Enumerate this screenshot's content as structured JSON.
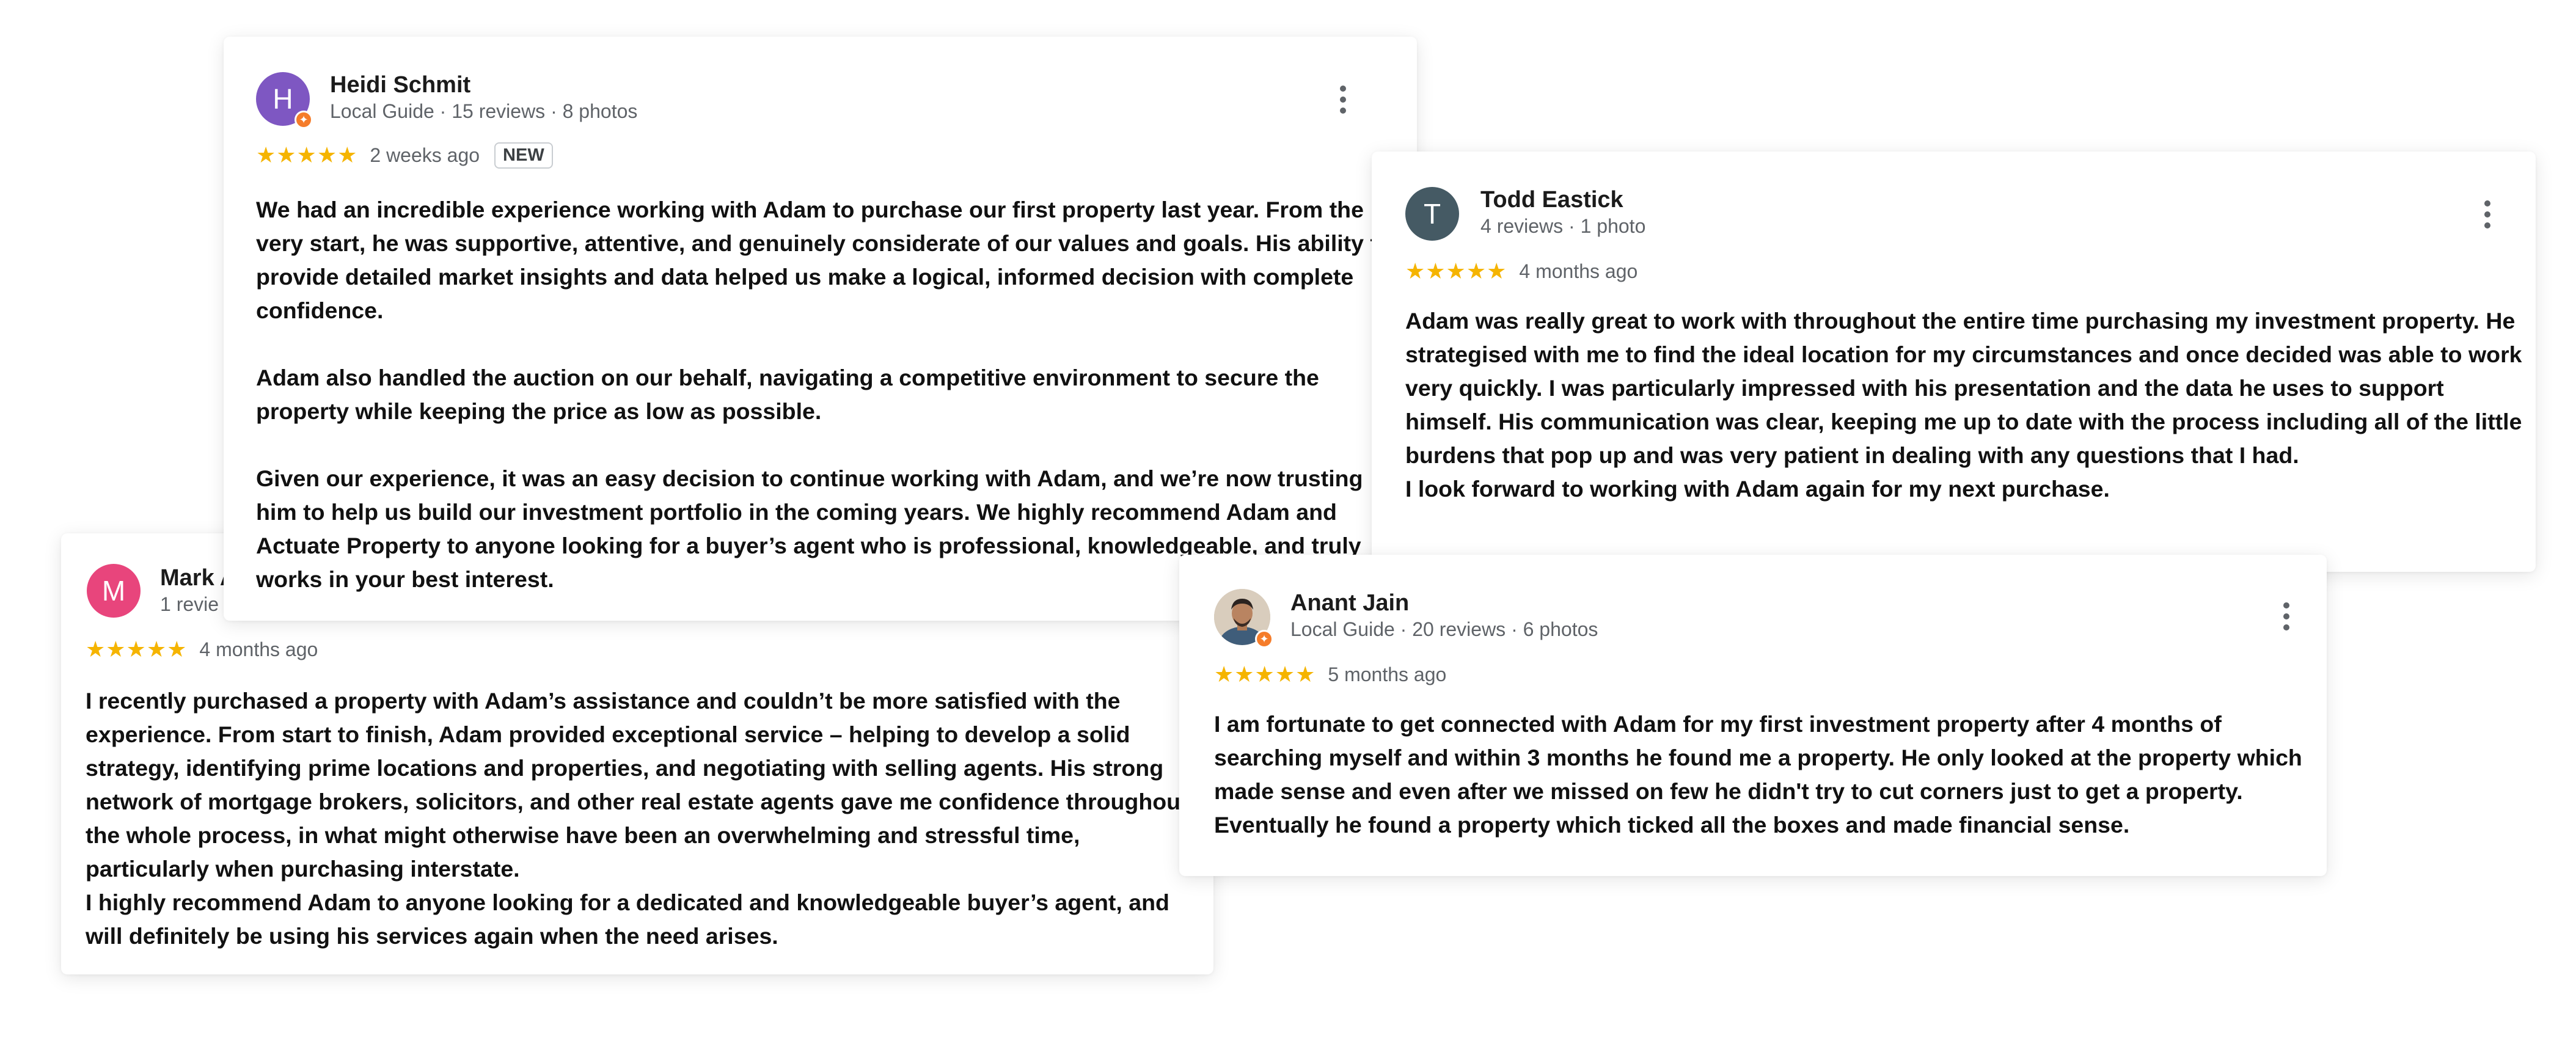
{
  "reviews": {
    "heidi": {
      "avatar_letter": "H",
      "avatar_color": "#7e57c2",
      "name": "Heidi Schmit",
      "meta": "Local Guide · 15 reviews · 8 photos",
      "stars": "★★★★★",
      "rating": 5,
      "date": "2 weeks ago",
      "badge": "NEW",
      "text": [
        "We had an incredible experience working with Adam to purchase our first property last year. From the very start, he was supportive, attentive, and genuinely considerate of our values and goals. His ability to provide detailed market insights and data helped us make a logical, informed decision with complete confidence.",
        "Adam also handled the auction on our behalf, navigating a competitive environment to secure the property while keeping the price as low as possible.",
        "Given our experience, it was an easy decision to continue working with Adam, and we’re now trusting him to help us build our investment portfolio in the coming years. We highly recommend Adam and Actuate Property to anyone looking for a buyer’s agent who is professional, knowledgeable, and truly works in your best interest."
      ]
    },
    "todd": {
      "avatar_letter": "T",
      "avatar_color": "#455a64",
      "name": "Todd Eastick",
      "meta": "4 reviews · 1 photo",
      "stars": "★★★★★",
      "rating": 5,
      "date": "4 months ago",
      "text": [
        "Adam was really great to work with throughout the entire time purchasing my investment property. He strategised with me to find the ideal location for my circumstances and once decided was able to work very quickly. I was particularly impressed with his presentation and the data he uses to support himself. His communication was clear, keeping me up to date with the process including all of the little burdens that pop up and was very patient in dealing with any questions that I had.",
        "I look forward to working with Adam again for my next purchase."
      ]
    },
    "mark": {
      "avatar_letter": "M",
      "avatar_color": "#e8457c",
      "name": "Mark A",
      "meta": "1 revie",
      "stars": "★★★★★",
      "rating": 5,
      "date": "4 months ago",
      "text": [
        "I recently purchased a property with Adam’s assistance and couldn’t be more satisfied with the experience. From start to finish, Adam provided exceptional service – helping to develop a solid strategy, identifying prime locations and properties, and negotiating with selling agents. His strong network of mortgage brokers, solicitors, and other real estate agents gave me confidence throughout the whole process, in what might otherwise have been an overwhelming and stressful time, particularly when purchasing interstate.",
        "I highly recommend Adam to anyone looking for a dedicated and knowledgeable buyer’s agent, and will definitely be using his services again when the need arises."
      ]
    },
    "anant": {
      "name": "Anant Jain",
      "meta": "Local Guide · 20 reviews · 6 photos",
      "stars": "★★★★★",
      "rating": 5,
      "date": "5 months ago",
      "text": [
        "I am fortunate to get connected with Adam for my first investment property after 4 months of searching myself and within 3 months he found me a property. He only looked at the property which made sense and even after we missed on few he didn't try to cut corners just to get a property. Eventually he found a property which ticked all the boxes and made financial sense."
      ]
    }
  },
  "icons": {
    "more_menu": "more-vert-icon",
    "local_guide": "local-guide-badge-icon",
    "star": "star-icon"
  },
  "colors": {
    "star": "#f5b400",
    "guide_badge": "#f57c2a",
    "muted_text": "#5f6368"
  }
}
